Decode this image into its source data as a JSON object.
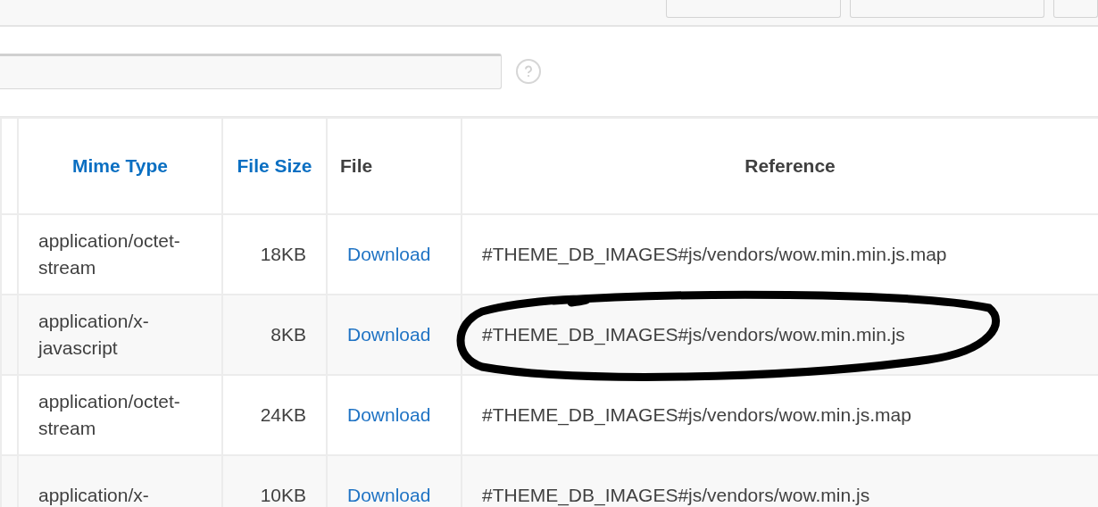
{
  "columns": [
    {
      "label": "Mime Type",
      "sortable": true
    },
    {
      "label": "File Size",
      "sortable": true
    },
    {
      "label": "File",
      "sortable": false
    },
    {
      "label": "Reference",
      "sortable": false
    }
  ],
  "rows": [
    {
      "mime_type": "application/octet-stream",
      "file_size": "18KB",
      "file": "Download",
      "reference": "#THEME_DB_IMAGES#js/vendors/wow.min.min.js.map",
      "circled": false
    },
    {
      "mime_type": "application/x-javascript",
      "file_size": "8KB",
      "file": "Download",
      "reference": "#THEME_DB_IMAGES#js/vendors/wow.min.min.js",
      "circled": true
    },
    {
      "mime_type": "application/octet-stream",
      "file_size": "24KB",
      "file": "Download",
      "reference": "#THEME_DB_IMAGES#js/vendors/wow.min.js.map",
      "circled": false
    },
    {
      "mime_type": "application/x-",
      "file_size": "10KB",
      "file": "Download",
      "reference": "#THEME_DB_IMAGES#js/vendors/wow.min.js",
      "circled": false
    }
  ]
}
